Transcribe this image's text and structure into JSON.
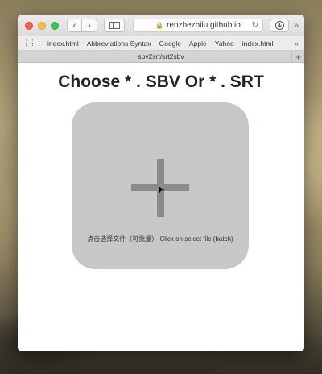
{
  "browser": {
    "address": "renzhezhilu.github.io",
    "more_label": "»"
  },
  "bookmarks": {
    "items": [
      "index.html",
      "Abbreviations Syntax",
      "Google",
      "Apple",
      "Yahoo",
      "index.html"
    ],
    "more_label": "»"
  },
  "tab": {
    "title": "sbv2srt/srt2sbv",
    "new_tab_label": "+"
  },
  "page": {
    "heading": "Choose * . SBV Or * . SRT",
    "dropzone_text": "点击选择文件（可批量） Click on select file (batch)"
  },
  "colors": {
    "dropzone_bg": "#c6c8c6",
    "plus_color": "#8a8c8a"
  }
}
